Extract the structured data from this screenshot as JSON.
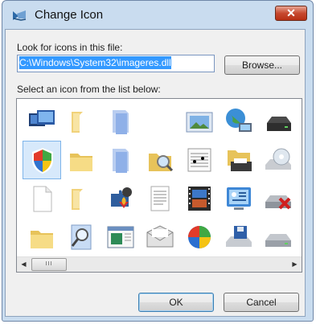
{
  "window": {
    "title": "Change Icon",
    "close_label": "✕"
  },
  "look_for_label": "Look for icons in this file:",
  "file_path": "C:\\Windows\\System32\\imageres.dll",
  "browse_label": "Browse...",
  "select_label": "Select an icon from the list below:",
  "scrollbar": {
    "left_arrow": "◀",
    "right_arrow": "▶",
    "thumb_grip": "III"
  },
  "ok_label": "OK",
  "cancel_label": "Cancel",
  "icons": [
    [
      "windows-monitors-icon",
      "folder-half-icon",
      "blue-pages-icon",
      "blank-icon",
      "picture-frame-icon",
      "globe-network-icon",
      "drive-dark-icon"
    ],
    [
      "security-shield-icon",
      "folder-icon",
      "blue-pages-icon",
      "folder-search-icon",
      "music-sheet-icon",
      "printer-folder-icon",
      "cd-drive-icon"
    ],
    [
      "blank-page-icon",
      "folder-half-icon",
      "puzzle-suits-icon",
      "text-document-icon",
      "filmstrip-icon",
      "control-panel-icon",
      "drive-x-icon"
    ],
    [
      "folder-icon",
      "search-document-icon",
      "window-app-icon",
      "envelope-icon",
      "windows-shield-icon",
      "floppy-drive-icon",
      "drive-gray-icon"
    ]
  ],
  "selected_icon": [
    1,
    0
  ]
}
